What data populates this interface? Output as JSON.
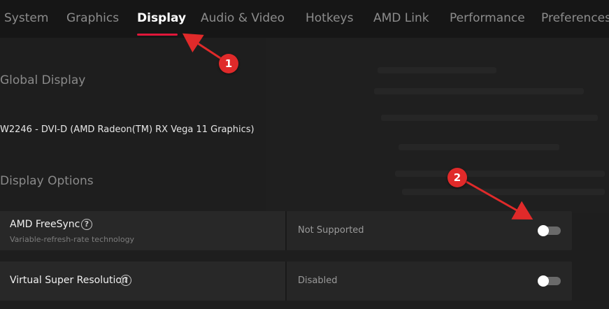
{
  "tabs": [
    {
      "label": "System",
      "active": false
    },
    {
      "label": "Graphics",
      "active": false
    },
    {
      "label": "Display",
      "active": true
    },
    {
      "label": "Audio & Video",
      "active": false
    },
    {
      "label": "Hotkeys",
      "active": false
    },
    {
      "label": "AMD Link",
      "active": false
    },
    {
      "label": "Performance",
      "active": false
    },
    {
      "label": "Preferences",
      "active": false
    }
  ],
  "global_display": {
    "title": "Global Display",
    "device": "W2246 - DVI-D (AMD Radeon(TM) RX Vega 11 Graphics)"
  },
  "display_options": {
    "title": "Display Options",
    "items": [
      {
        "label": "AMD FreeSync",
        "description": "Variable-refresh-rate technology",
        "value": "Not Supported",
        "toggle_on": false
      },
      {
        "label": "Virtual Super Resolution",
        "value": "Disabled",
        "toggle_on": false
      }
    ]
  },
  "annotations": {
    "badge_1": "1",
    "badge_2": "2"
  },
  "colors": {
    "accent": "#e0173a",
    "annotation": "#e02a2a",
    "background": "#1e1e1e"
  }
}
